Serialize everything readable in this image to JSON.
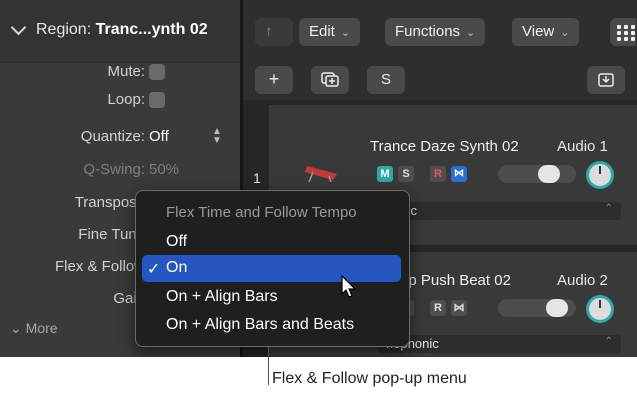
{
  "inspector": {
    "region_prefix": "Region: ",
    "region_name": "Tranc...ynth 02",
    "rows": [
      {
        "label": "Mute:",
        "kind": "checkbox"
      },
      {
        "label": "Loop:",
        "kind": "checkbox"
      },
      {
        "label": "Quantize:",
        "value": "Off",
        "kind": "popup"
      },
      {
        "label": "Q-Swing:",
        "value": "50%",
        "kind": "dim"
      },
      {
        "label": "Transpose",
        "kind": "label"
      },
      {
        "label": "Fine Tune",
        "kind": "label"
      },
      {
        "label": "Flex & Follow",
        "kind": "label"
      },
      {
        "label": "Gain",
        "kind": "label"
      }
    ],
    "more_label": "More"
  },
  "toolbar": {
    "edit_label": "Edit",
    "functions_label": "Functions",
    "view_label": "View",
    "add_label": "+",
    "solo_label": "S"
  },
  "tracks": [
    {
      "number": "1",
      "name": "Trance Daze Synth 02",
      "output": "Audio 1",
      "flex_mode": "Rhythmic",
      "flex_mode_visible": "thmic"
    },
    {
      "number": "",
      "name": "Deep Push Beat 02",
      "name_visible": "ep Push Beat 02",
      "output": "Audio 2",
      "flex_mode": "Monophonic",
      "flex_mode_visible": "nophonic"
    }
  ],
  "track_buttons": {
    "mute": "M",
    "solo": "S",
    "record": "R"
  },
  "popup_menu": {
    "header": "Flex Time and Follow Tempo",
    "items": [
      {
        "label": "Off",
        "selected": false
      },
      {
        "label": "On",
        "selected": true
      },
      {
        "label": "On + Align Bars",
        "selected": false
      },
      {
        "label": "On + Align Bars and Beats",
        "selected": false
      }
    ],
    "checkmark": "✓"
  },
  "callout": {
    "text": "Flex & Follow pop-up menu"
  },
  "colors": {
    "accent": "#2556c2",
    "mute": "#2ea9a6",
    "record": "#e05a50",
    "flex": "#2b6fd1"
  }
}
